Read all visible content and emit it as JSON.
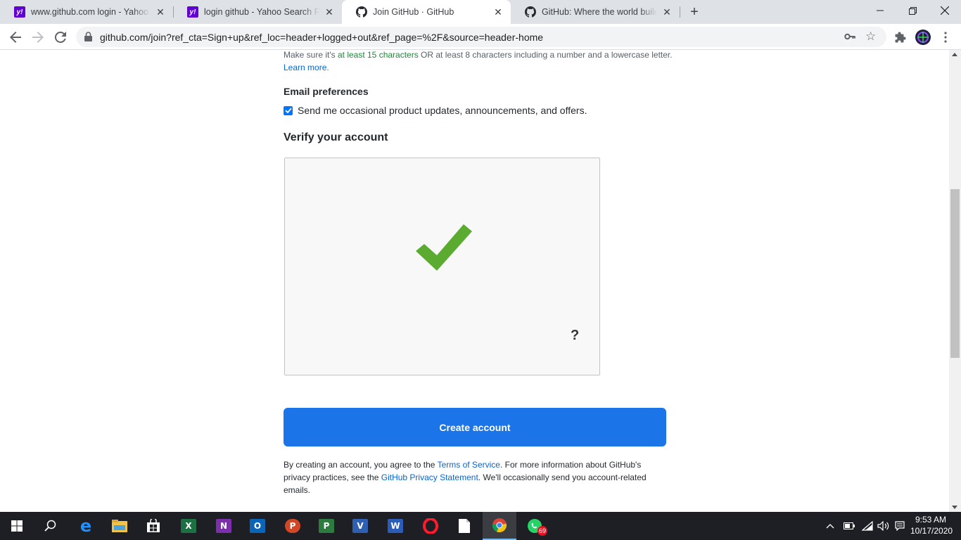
{
  "browser": {
    "tabs": [
      {
        "title": "www.github.com login - Yahoo Search",
        "favicon": "yahoo-icon"
      },
      {
        "title": "login github - Yahoo Search Results",
        "favicon": "yahoo-icon"
      },
      {
        "title": "Join GitHub · GitHub",
        "favicon": "github-icon",
        "active": true
      },
      {
        "title": "GitHub: Where the world builds software",
        "favicon": "github-icon"
      }
    ],
    "url": "github.com/join?ref_cta=Sign+up&ref_loc=header+logged+out&ref_page=%2F&source=header-home"
  },
  "page": {
    "hint_prefix": "Make sure it's ",
    "hint_green": "at least 15 characters",
    "hint_suffix": " OR at least 8 characters including a number and a lowercase letter.",
    "hint_link": "Learn more.",
    "email_label": "Email preferences",
    "email_checkbox_label": "Send me occasional product updates, announcements, and offers.",
    "email_checkbox_checked": true,
    "verify_title": "Verify your account",
    "captcha_help": "?",
    "create_button": "Create account",
    "legal_1": "By creating an account, you agree to the ",
    "legal_tos": "Terms of Service",
    "legal_2": ". For more information about GitHub's privacy practices, see the ",
    "legal_privacy": "GitHub Privacy Statement",
    "legal_3": ". We'll occasionally send you account-related emails."
  },
  "taskbar": {
    "time": "9:53 AM",
    "date": "10/17/2020",
    "whatsapp_badge": "69"
  },
  "colors": {
    "primary_button": "#1b74e8",
    "link": "#0366d6",
    "green_hint": "#22863a",
    "checkmark": "#5aab2f"
  }
}
